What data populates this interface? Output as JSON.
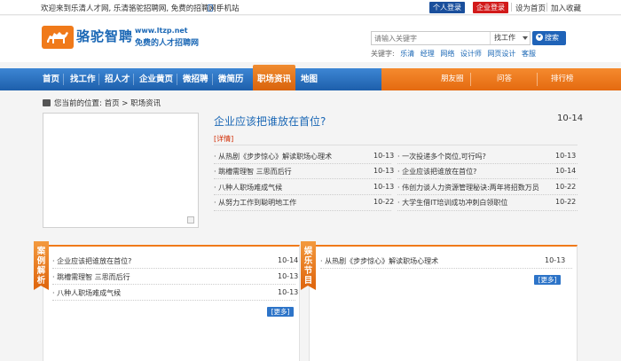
{
  "topbar": {
    "welcome": "欢迎来到乐清人才网, 乐清骆驼招聘网, 免费的招聘网!",
    "mobile": "手机站",
    "person_login": "个人登录",
    "company_login": "企业登录",
    "set_home": "设为首页",
    "add_favorite": "加入收藏"
  },
  "header": {
    "logo_name": "骆驼智聘",
    "logo_url": "www.ltzp.net",
    "slogan": "免费的人才招聘网",
    "search_placeholder": "请输入关键字",
    "search_select": "找工作",
    "search_button": "搜索",
    "keywords_label": "关键字:",
    "keywords": [
      "乐清",
      "经理",
      "网络",
      "设计师",
      "网页设计",
      "客服"
    ]
  },
  "nav": {
    "items": [
      "首页",
      "找工作",
      "招人才",
      "企业黄页",
      "微招聘",
      "微简历",
      "职场资讯",
      "地图"
    ],
    "active": "职场资讯",
    "right_items": [
      "朋友圈",
      "问答",
      "排行榜"
    ]
  },
  "breadcrumb": {
    "label": "您当前的位置:",
    "home": "首页",
    "sep": ">",
    "current": "职场资讯"
  },
  "featured": {
    "title": "企业应该把谁放在首位?",
    "date": "10-14",
    "detail": "[详情]"
  },
  "articles_left": [
    {
      "title": "从热剧《步步惊心》解读职场心理术",
      "date": "10-13"
    },
    {
      "title": "跳槽需理智 三思而后行",
      "date": "10-13"
    },
    {
      "title": "八种人职场难成气候",
      "date": "10-13"
    },
    {
      "title": "从努力工作到聪明地工作",
      "date": "10-22"
    }
  ],
  "articles_right": [
    {
      "title": "一次投递多个岗位,可行吗?",
      "date": "10-13"
    },
    {
      "title": "企业应该把谁放在首位?",
      "date": "10-14"
    },
    {
      "title": "伟创力谈人力资源管理秘诀:两年将招数万员",
      "date": "10-22"
    },
    {
      "title": "大学生借IT培训成功冲刺白领职位",
      "date": "10-22"
    }
  ],
  "box_left": {
    "ribbon": "案例解析",
    "items": [
      {
        "title": "企业应该把谁放在首位?",
        "date": "10-14"
      },
      {
        "title": "跳槽需理智 三思而后行",
        "date": "10-13"
      },
      {
        "title": "八种人职场难成气候",
        "date": "10-13"
      }
    ],
    "more": "[更多]"
  },
  "box_right": {
    "ribbon": "娱乐节目",
    "items": [
      {
        "title": "从热剧《步步惊心》解读职场心理术",
        "date": "10-13"
      }
    ],
    "more": "[更多]"
  },
  "colors": {
    "brand_blue": "#1a67b5",
    "brand_orange": "#f07a1a",
    "login_person": "#1a4f9c",
    "login_company": "#d21a1a",
    "detail_red": "#d02a00"
  },
  "icons": [
    "camel-logo-icon",
    "phone-icon",
    "search-icon",
    "home-icon",
    "chevron-down-icon",
    "image-caption-icon"
  ]
}
